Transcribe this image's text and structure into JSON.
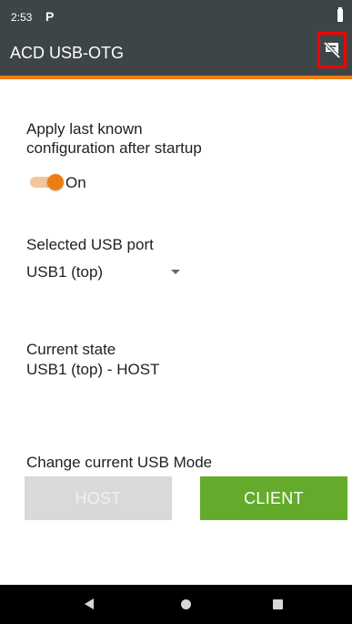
{
  "status_bar": {
    "time": "2:53",
    "notification": "P"
  },
  "app_bar": {
    "title": "ACD USB-OTG",
    "action_icon": "notifications-off-icon"
  },
  "startup_setting": {
    "label_line1": "Apply last known",
    "label_line2": "configuration after startup",
    "toggle_state": "On",
    "toggle_on": true
  },
  "usb_port": {
    "label": "Selected USB port",
    "selected": "USB1 (top)"
  },
  "current_state": {
    "label": "Current state",
    "value": "USB1 (top) - HOST"
  },
  "usb_mode": {
    "label": "Change current USB Mode",
    "host_button": "HOST",
    "client_button": "CLIENT"
  },
  "colors": {
    "app_bar": "#3e4548",
    "accent": "#ee7d11",
    "client_button": "#64ab2c",
    "host_button_disabled": "#d7d9da"
  },
  "nav_bar": {
    "back": "back-icon",
    "home": "home-icon",
    "recents": "recents-icon"
  }
}
